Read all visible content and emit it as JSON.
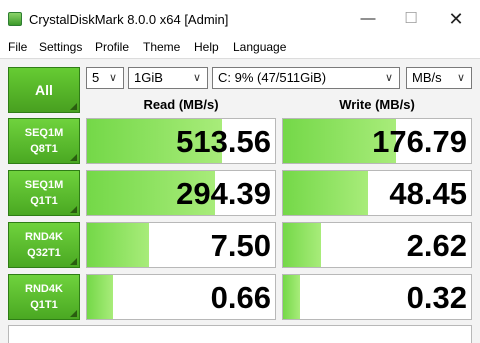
{
  "window": {
    "title": "CrystalDiskMark 8.0.0 x64 [Admin]",
    "minimize_glyph": "—",
    "maximize_glyph": "☐",
    "close_glyph": "✕"
  },
  "menu": [
    "File",
    "Settings",
    "Profile",
    "Theme",
    "Help",
    "Language"
  ],
  "controls": {
    "all_label": "All",
    "count": "5",
    "size": "1GiB",
    "drive": "C: 9% (47/511GiB)",
    "unit": "MB/s"
  },
  "headers": {
    "read": "Read (MB/s)",
    "write": "Write (MB/s)"
  },
  "tests": [
    {
      "line1": "SEQ1M",
      "line2": "Q8T1",
      "read": "513.56",
      "write": "176.79",
      "read_fill": 0.72,
      "write_fill": 0.6
    },
    {
      "line1": "SEQ1M",
      "line2": "Q1T1",
      "read": "294.39",
      "write": "48.45",
      "read_fill": 0.68,
      "write_fill": 0.45
    },
    {
      "line1": "RND4K",
      "line2": "Q32T1",
      "read": "7.50",
      "write": "2.62",
      "read_fill": 0.33,
      "write_fill": 0.2
    },
    {
      "line1": "RND4K",
      "line2": "Q1T1",
      "read": "0.66",
      "write": "0.32",
      "read_fill": 0.14,
      "write_fill": 0.09
    }
  ],
  "colors": {
    "accent_green": "#48a020",
    "bar_green": "#74d848"
  }
}
